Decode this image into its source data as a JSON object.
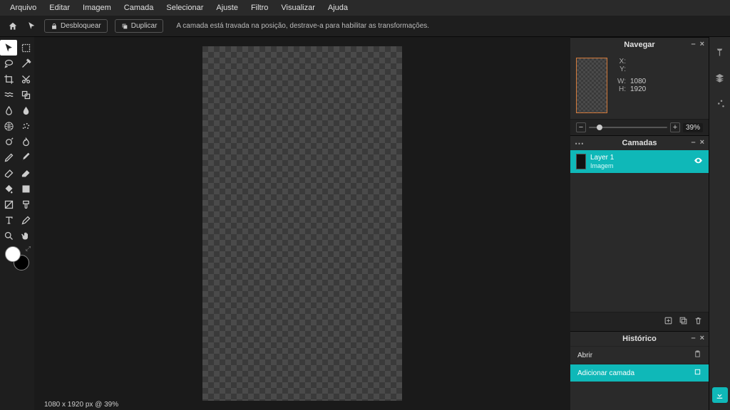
{
  "menu": [
    "Arquivo",
    "Editar",
    "Imagem",
    "Camada",
    "Selecionar",
    "Ajuste",
    "Filtro",
    "Visualizar",
    "Ajuda"
  ],
  "toolbar": {
    "unlock": "Desbloquear",
    "duplicate": "Duplicar",
    "hint": "A camada está travada na posição, destrave-a para habilitar as transformações."
  },
  "nav": {
    "title": "Navegar",
    "x_label": "X:",
    "y_label": "Y:",
    "w_label": "W:",
    "h_label": "H:",
    "w": "1080",
    "h": "1920",
    "zoom": "39%"
  },
  "layers": {
    "title": "Camadas",
    "items": [
      {
        "name": "Layer 1",
        "type": "Imagem"
      }
    ]
  },
  "history": {
    "title": "Histórico",
    "items": [
      {
        "label": "Abrir",
        "active": false
      },
      {
        "label": "Adicionar camada",
        "active": true
      }
    ]
  },
  "status": "1080 x 1920 px @ 39%",
  "tools": [
    [
      "arrow",
      "marquee"
    ],
    [
      "lasso",
      "wand"
    ],
    [
      "crop",
      "cut"
    ],
    [
      "liquify",
      "clone"
    ],
    [
      "blur",
      "droplet"
    ],
    [
      "mesh",
      "spray"
    ],
    [
      "dodge",
      "burn"
    ],
    [
      "pen",
      "brush"
    ],
    [
      "eraser",
      "eraser2"
    ],
    [
      "fill",
      "gradient"
    ],
    [
      "shape",
      "paint"
    ],
    [
      "text",
      "picker"
    ],
    [
      "zoom",
      "hand"
    ]
  ]
}
